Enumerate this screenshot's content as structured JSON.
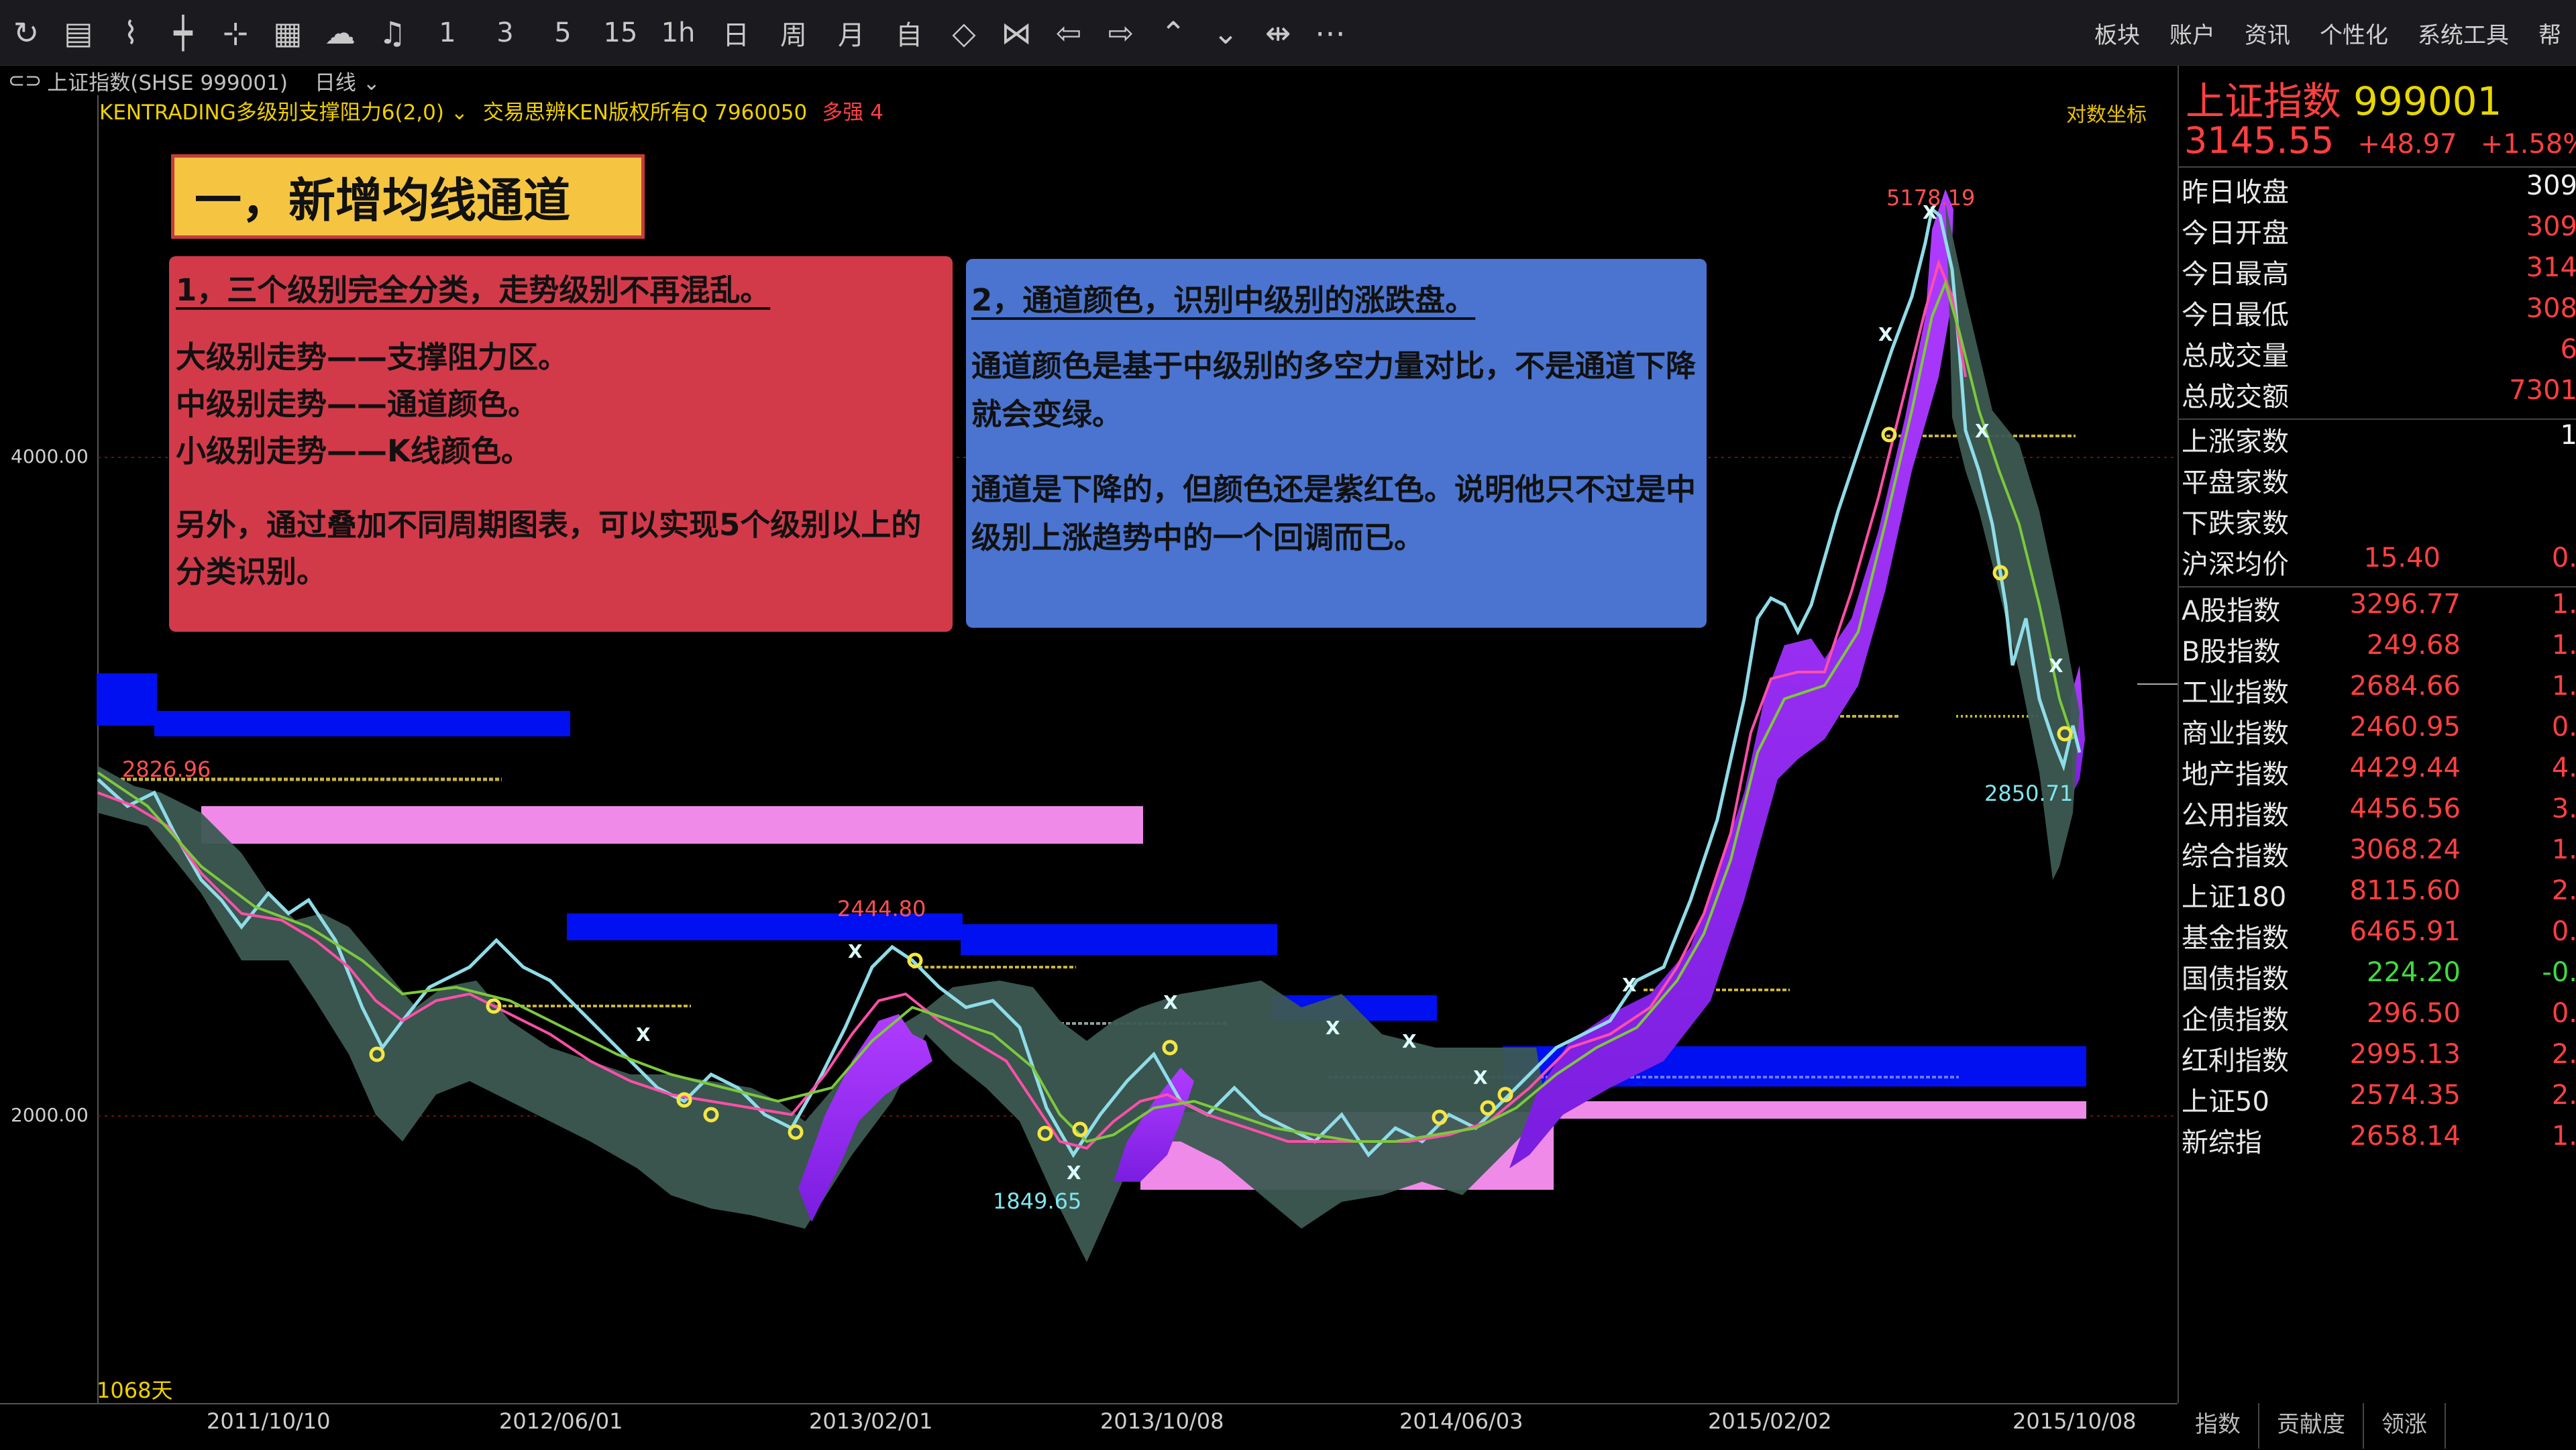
{
  "toolbar": {
    "icons": [
      "refresh-icon",
      "list-icon",
      "line-chart-icon",
      "candlestick-icon",
      "kline-icon",
      "grid-icon",
      "cloud-icon",
      "bell-icon"
    ],
    "periods": [
      "1",
      "3",
      "5",
      "15",
      "1h",
      "日",
      "周",
      "月",
      "自"
    ],
    "nav_icons": [
      "overlay-icon",
      "compare-icon",
      "left-icon",
      "right-icon",
      "zoom-in-icon",
      "zoom-out-icon",
      "fit-icon",
      "more-icon"
    ],
    "menu": [
      "板块",
      "账户",
      "资讯",
      "个性化",
      "系统工具",
      "帮"
    ]
  },
  "header": {
    "symbol": "上证指数(SHSE 999001)",
    "period": "日线",
    "indicator": "KENTRADING多级别支撑阻力6(2,0)",
    "copyright": "交易思辨KEN版权所有Q 7960050",
    "trend": "多强 4",
    "log_scale": "对数坐标"
  },
  "annotations": {
    "title": "一，新增均线通道",
    "red_head": "1，三个级别完全分类，走势级别不再混乱。",
    "red_lines": [
      "大级别走势——支撑阻力区。",
      "中级别走势——通道颜色。",
      "小级别走势——K线颜色。"
    ],
    "red_extra": "另外，通过叠加不同周期图表，可以实现5个级别以上的分类识别。",
    "blue_head": "2，通道颜色，识别中级别的涨跌盘。",
    "blue_p1": "通道颜色是基于中级别的多空力量对比，不是通道下降就会变绿。",
    "blue_p2": "通道是下降的，但颜色还是紫红色。说明他只不过是中级别上涨趋势中的一个回调而已。"
  },
  "price_labels": {
    "high": "5178.19",
    "p2826": "2826.96",
    "p2444": "2444.80",
    "low": "1849.65",
    "p2850": "2850.71",
    "days": "1068天",
    "axis_4000": "4000.00",
    "axis_2000": "2000.00"
  },
  "dates": [
    "2011/10/10",
    "2012/06/01",
    "2013/02/01",
    "2013/10/08",
    "2014/06/03",
    "2015/02/02",
    "2015/10/08"
  ],
  "quote": {
    "name": "上证指数",
    "code": "999001",
    "price": "3145.55",
    "change": "+48.97",
    "change_pct": "+1.58%"
  },
  "stats": [
    {
      "label": "昨日收盘",
      "value": "309"
    },
    {
      "label": "今日开盘",
      "value": "309"
    },
    {
      "label": "今日最高",
      "value": "314"
    },
    {
      "label": "今日最低",
      "value": "308"
    },
    {
      "label": "总成交量",
      "value": "6"
    },
    {
      "label": "总成交额",
      "value": "7301"
    }
  ],
  "breadth": [
    {
      "label": "上涨家数",
      "value": "1"
    },
    {
      "label": "平盘家数",
      "value": ""
    },
    {
      "label": "下跌家数",
      "value": ""
    },
    {
      "label": "沪深均价",
      "value": "15.40",
      "extra": "0."
    }
  ],
  "indices": [
    {
      "label": "A股指数",
      "value": "3296.77",
      "extra": "1."
    },
    {
      "label": "B股指数",
      "value": "249.68",
      "extra": "1."
    },
    {
      "label": "工业指数",
      "value": "2684.66",
      "extra": "1."
    },
    {
      "label": "商业指数",
      "value": "2460.95",
      "extra": "0."
    },
    {
      "label": "地产指数",
      "value": "4429.44",
      "extra": "4."
    },
    {
      "label": "公用指数",
      "value": "4456.56",
      "extra": "3."
    },
    {
      "label": "综合指数",
      "value": "3068.24",
      "extra": "1."
    },
    {
      "label": "上证180",
      "value": "8115.60",
      "extra": "2."
    },
    {
      "label": "基金指数",
      "value": "6465.91",
      "extra": "0."
    },
    {
      "label": "国债指数",
      "value": "224.20",
      "extra": "-0."
    },
    {
      "label": "企债指数",
      "value": "296.50",
      "extra": "0."
    },
    {
      "label": "红利指数",
      "value": "2995.13",
      "extra": "2."
    },
    {
      "label": "上证50",
      "value": "2574.35",
      "extra": "2."
    },
    {
      "label": "新综指",
      "value": "2658.14",
      "extra": "1."
    }
  ],
  "bottom_tabs": [
    "指数",
    "贡献度",
    "领涨"
  ],
  "colors": {
    "up": "#ff4040",
    "accent": "#e8d800",
    "channel_up": "#9a2bff",
    "channel_mid": "#3c5a52",
    "zone_blue": "#0010f0",
    "zone_pink": "#f08ae8"
  }
}
